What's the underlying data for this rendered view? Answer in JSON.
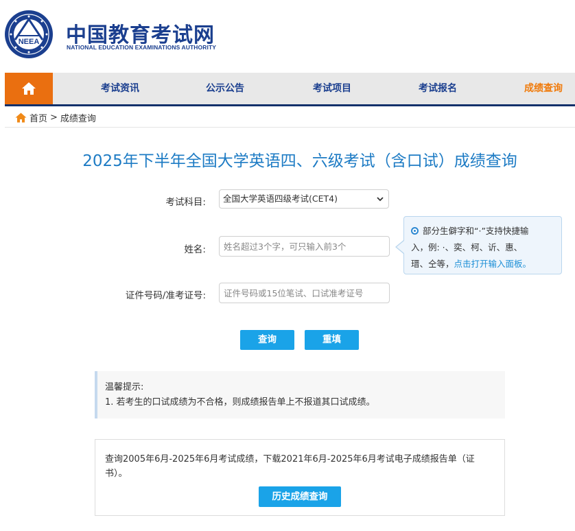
{
  "header": {
    "logo_emblem_text": "NEEA",
    "logo_cn": "中国教育考试网",
    "logo_en": "NATIONAL EDUCATION EXAMINATIONS AUTHORITY"
  },
  "nav": {
    "home_icon": "home-icon",
    "items": [
      {
        "label": "考试资讯"
      },
      {
        "label": "公示公告"
      },
      {
        "label": "考试项目"
      },
      {
        "label": "考试报名"
      },
      {
        "label": "成绩查询",
        "active": true
      }
    ],
    "accent_color": "#ea6f10",
    "active_color": "#f07a0a"
  },
  "breadcrumb": {
    "home_label": "首页",
    "separator": ">",
    "current": "成绩查询"
  },
  "page_title": "2025年下半年全国大学英语四、六级考试（含口试）成绩查询",
  "form": {
    "subject_label": "考试科目:",
    "subject_value": "全国大学英语四级考试(CET4)",
    "name_label": "姓名:",
    "name_placeholder": "姓名超过3个字，可只输入前3个",
    "id_label": "证件号码/准考证号:",
    "id_placeholder": "证件号码或15位笔试、口试准考证号"
  },
  "tip": {
    "line1": "部分生僻字和“·”支持快捷输",
    "line2": "入，例: ·、奕、柯、䜣、惠、",
    "line3_prefix": "瑨、仝等，",
    "line3_link": "点击打开输入面板。"
  },
  "buttons": {
    "query": "查询",
    "reset": "重填"
  },
  "notice": {
    "title": "温馨提示:",
    "item1": "1. 若考生的口试成绩为不合格，则成绩报告单上不报道其口试成绩。"
  },
  "history": {
    "text": "查询2005年6月-2025年6月考试成绩，下载2021年6月-2025年6月考试电子成绩报告单（证书）。",
    "button": "历史成绩查询"
  }
}
